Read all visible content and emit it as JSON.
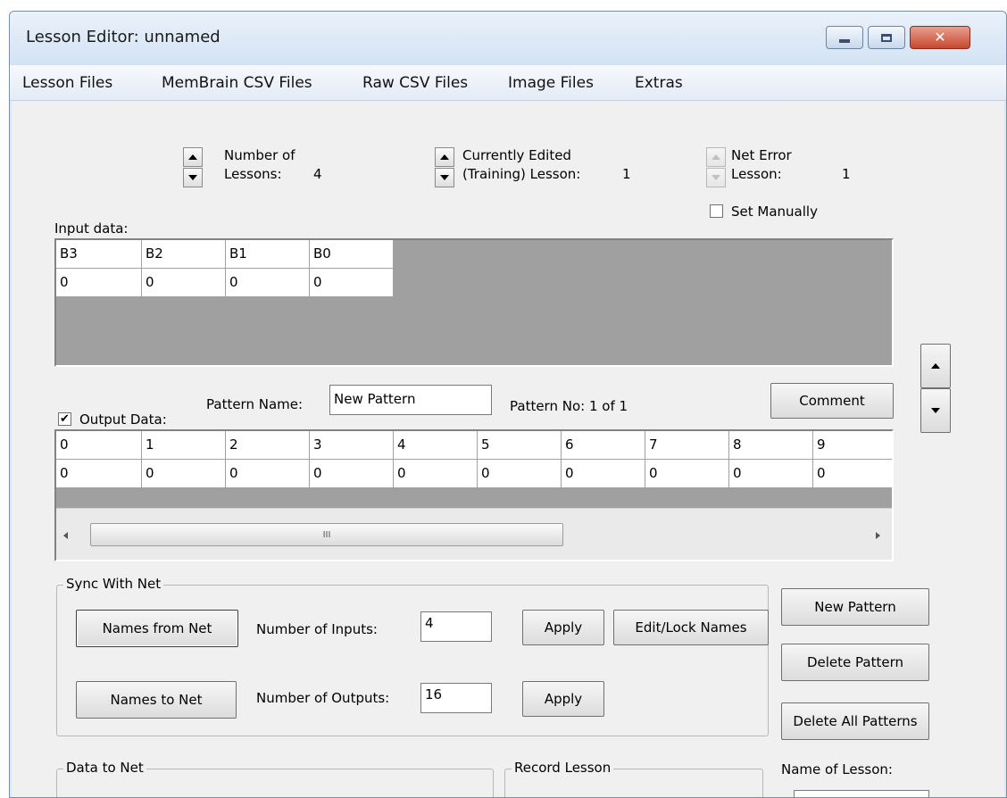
{
  "window": {
    "title": "Lesson Editor: unnamed",
    "controls": {
      "minimize": "minimize-icon",
      "maximize": "maximize-icon",
      "close": "close-icon"
    }
  },
  "menu": [
    {
      "label": "Lesson Files"
    },
    {
      "label": "MemBrain CSV Files"
    },
    {
      "label": "Raw CSV Files"
    },
    {
      "label": "Image Files"
    },
    {
      "label": "Extras"
    }
  ],
  "counters": {
    "lessons": {
      "line1": "Number of",
      "line2": "Lessons:",
      "value": "4"
    },
    "edited": {
      "line1": "Currently Edited",
      "line2": "(Training) Lesson:",
      "value": "1"
    },
    "net_error": {
      "line1": "Net Error",
      "line2": "Lesson:",
      "value": "1"
    }
  },
  "set_manually": {
    "label": "Set Manually",
    "checked": false
  },
  "input_data": {
    "label": "Input data:",
    "headers": [
      "B3",
      "B2",
      "B1",
      "B0"
    ],
    "values": [
      "0",
      "0",
      "0",
      "0"
    ]
  },
  "pattern": {
    "name_label": "Pattern Name:",
    "name_value": "New Pattern",
    "number_text": "Pattern No: 1 of 1",
    "comment_button": "Comment"
  },
  "output_data": {
    "label": "Output Data:",
    "checked": true,
    "check_mark": "✔",
    "headers": [
      "0",
      "1",
      "2",
      "3",
      "4",
      "5",
      "6",
      "7",
      "8",
      "9"
    ],
    "values": [
      "0",
      "0",
      "0",
      "0",
      "0",
      "0",
      "0",
      "0",
      "0",
      "0"
    ],
    "scroll_grip": "III"
  },
  "sync": {
    "legend": "Sync With Net",
    "names_from_net": "Names from Net",
    "names_to_net": "Names to Net",
    "inputs_label": "Number of Inputs:",
    "inputs_value": "4",
    "outputs_label": "Number of Outputs:",
    "outputs_value": "16",
    "apply": "Apply",
    "edit_lock": "Edit/Lock Names"
  },
  "pattern_buttons": {
    "new": "New Pattern",
    "delete": "Delete Pattern",
    "delete_all": "Delete All Patterns"
  },
  "bottom": {
    "data_to_net": "Data to Net",
    "record_lesson": "Record Lesson",
    "name_of_lesson": "Name of Lesson:"
  }
}
